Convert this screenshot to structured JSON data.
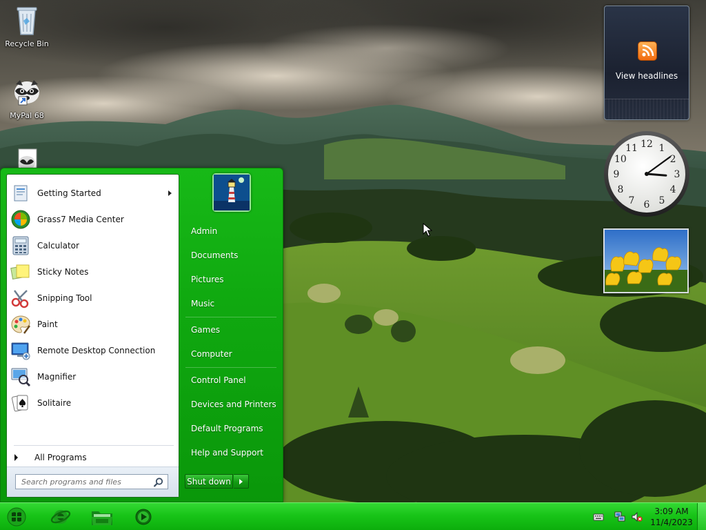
{
  "desktop": {
    "icons": [
      {
        "label": "Recycle Bin",
        "icon": "recycle-bin-icon"
      },
      {
        "label": "MyPal 68",
        "icon": "raccoon-shortcut-icon"
      }
    ]
  },
  "gadgets": {
    "feed": {
      "label": "View headlines",
      "icon": "rss-icon"
    },
    "clock": {
      "hour": 3,
      "minute": 9,
      "numerals": [
        "12",
        "1",
        "2",
        "3",
        "4",
        "5",
        "6",
        "7",
        "8",
        "9",
        "10",
        "11"
      ]
    },
    "slideshow": {
      "subject": "yellow tulips"
    }
  },
  "start_menu": {
    "programs": [
      {
        "label": "Getting Started",
        "icon": "getting-started-icon",
        "has_submenu": true
      },
      {
        "label": "Grass7 Media Center",
        "icon": "media-center-icon",
        "has_submenu": false
      },
      {
        "label": "Calculator",
        "icon": "calculator-icon",
        "has_submenu": false
      },
      {
        "label": "Sticky Notes",
        "icon": "sticky-notes-icon",
        "has_submenu": false
      },
      {
        "label": "Snipping Tool",
        "icon": "scissors-icon",
        "has_submenu": false
      },
      {
        "label": "Paint",
        "icon": "paint-palette-icon",
        "has_submenu": false
      },
      {
        "label": "Remote Desktop Connection",
        "icon": "remote-desktop-icon",
        "has_submenu": false
      },
      {
        "label": "Magnifier",
        "icon": "magnifier-icon",
        "has_submenu": false
      },
      {
        "label": "Solitaire",
        "icon": "playing-cards-icon",
        "has_submenu": false
      }
    ],
    "all_programs": "All Programs",
    "search_placeholder": "Search programs and files",
    "places": [
      {
        "label": "Admin"
      },
      {
        "label": "Documents"
      },
      {
        "label": "Pictures"
      },
      {
        "label": "Music"
      },
      {
        "label": "Games"
      },
      {
        "label": "Computer"
      },
      {
        "label": "Control Panel"
      },
      {
        "label": "Devices and Printers"
      },
      {
        "label": "Default Programs"
      },
      {
        "label": "Help and Support"
      }
    ],
    "shutdown_label": "Shut down",
    "user_picture": "lighthouse"
  },
  "taskbar": {
    "pinned": [
      {
        "name": "internet-explorer-icon"
      },
      {
        "name": "windows-explorer-folder-icon"
      },
      {
        "name": "media-player-icon"
      }
    ],
    "tray_icons": [
      "keyboard-icon",
      "network-icon",
      "volume-muted-icon"
    ],
    "time": "3:09 AM",
    "date": "11/4/2023"
  },
  "colors": {
    "accent": "#10a910",
    "taskbar": "#18c418",
    "menu_left_bg": "#ffffff"
  }
}
